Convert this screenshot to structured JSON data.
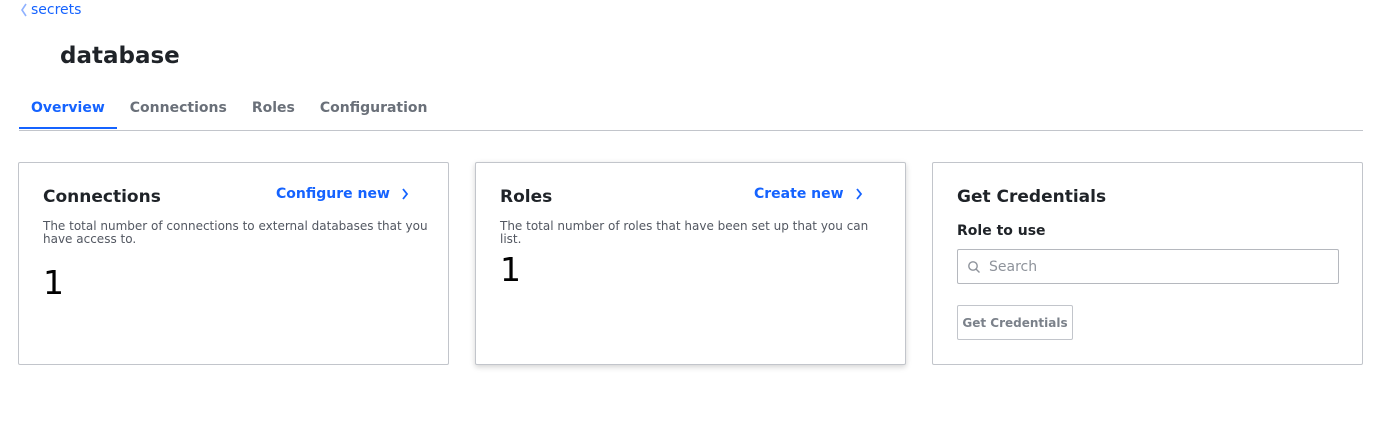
{
  "breadcrumb": {
    "label": "secrets"
  },
  "page": {
    "title": "database"
  },
  "tabs": [
    {
      "label": "Overview",
      "active": true
    },
    {
      "label": "Connections",
      "active": false
    },
    {
      "label": "Roles",
      "active": false
    },
    {
      "label": "Configuration",
      "active": false
    }
  ],
  "cards": {
    "connections": {
      "title": "Connections",
      "action": "Configure new",
      "description": "The total number of connections to external databases that you have access to.",
      "value": "1"
    },
    "roles": {
      "title": "Roles",
      "action": "Create new",
      "description": "The total number of roles that have been set up that you can list.",
      "value": "1"
    },
    "credentials": {
      "title": "Get Credentials",
      "field_label": "Role to use",
      "search_placeholder": "Search",
      "search_value": "",
      "button_label": "Get Credentials"
    }
  },
  "colors": {
    "accent": "#1563ff",
    "border": "#c2c5cb",
    "text": "#1f2328",
    "muted": "#6a7079"
  },
  "icons": {
    "breadcrumb": "chevron-left-icon",
    "card_action": "chevron-right-icon",
    "search": "search-icon"
  }
}
